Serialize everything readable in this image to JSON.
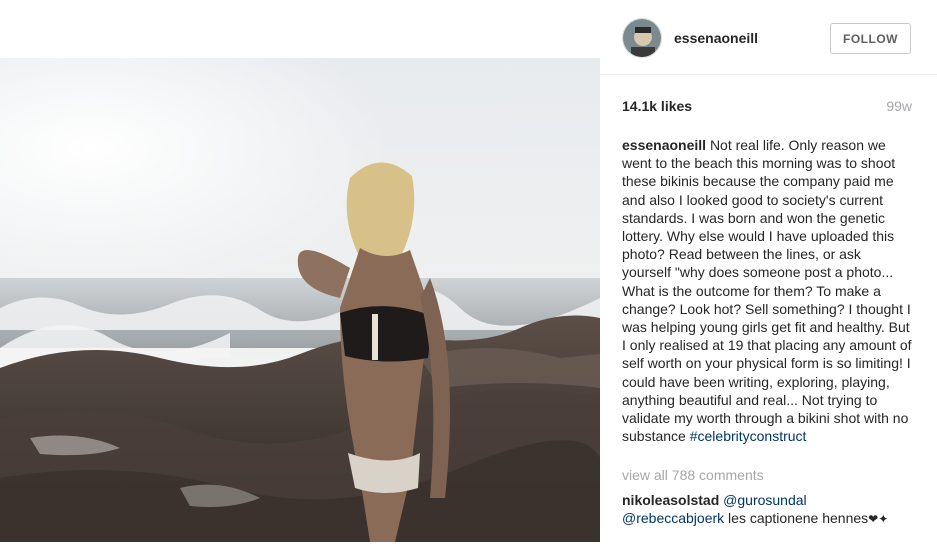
{
  "post": {
    "username": "essenaoneill",
    "follow_label": "FOLLOW",
    "likes": "14.1k likes",
    "age": "99w",
    "caption": {
      "author": "essenaoneill",
      "text": "Not real life. Only reason we went to the beach this morning was to shoot these bikinis because the company paid me and also I looked good to society's current standards. I was born and won the genetic lottery. Why else would I have uploaded this photo? Read between the lines, or ask yourself \"why does someone post a photo... What is the outcome for them? To make a change? Look hot? Sell something? I thought I was helping young girls get fit and healthy. But I only realised at 19 that placing any amount of self worth on your physical form is so limiting! I could have been writing, exploring, playing, anything beautiful and real... Not trying to validate my worth through a bikini shot with no substance",
      "hashtag": "#celebrityconstruct"
    },
    "view_all_comments": "view all 788 comments",
    "comments": [
      {
        "author": "nikoleasolstad",
        "mention": "@gurosundal",
        "text": ""
      },
      {
        "author": "",
        "mention": "@rebeccabjoerk",
        "text": "les captionene hennes"
      }
    ]
  },
  "icons": {
    "avatar": "avatar",
    "heart": "heart-emoji"
  },
  "colors": {
    "text": "#262626",
    "muted": "#a5a7aa",
    "link": "#003569",
    "button_border": "#c8c8c8"
  }
}
